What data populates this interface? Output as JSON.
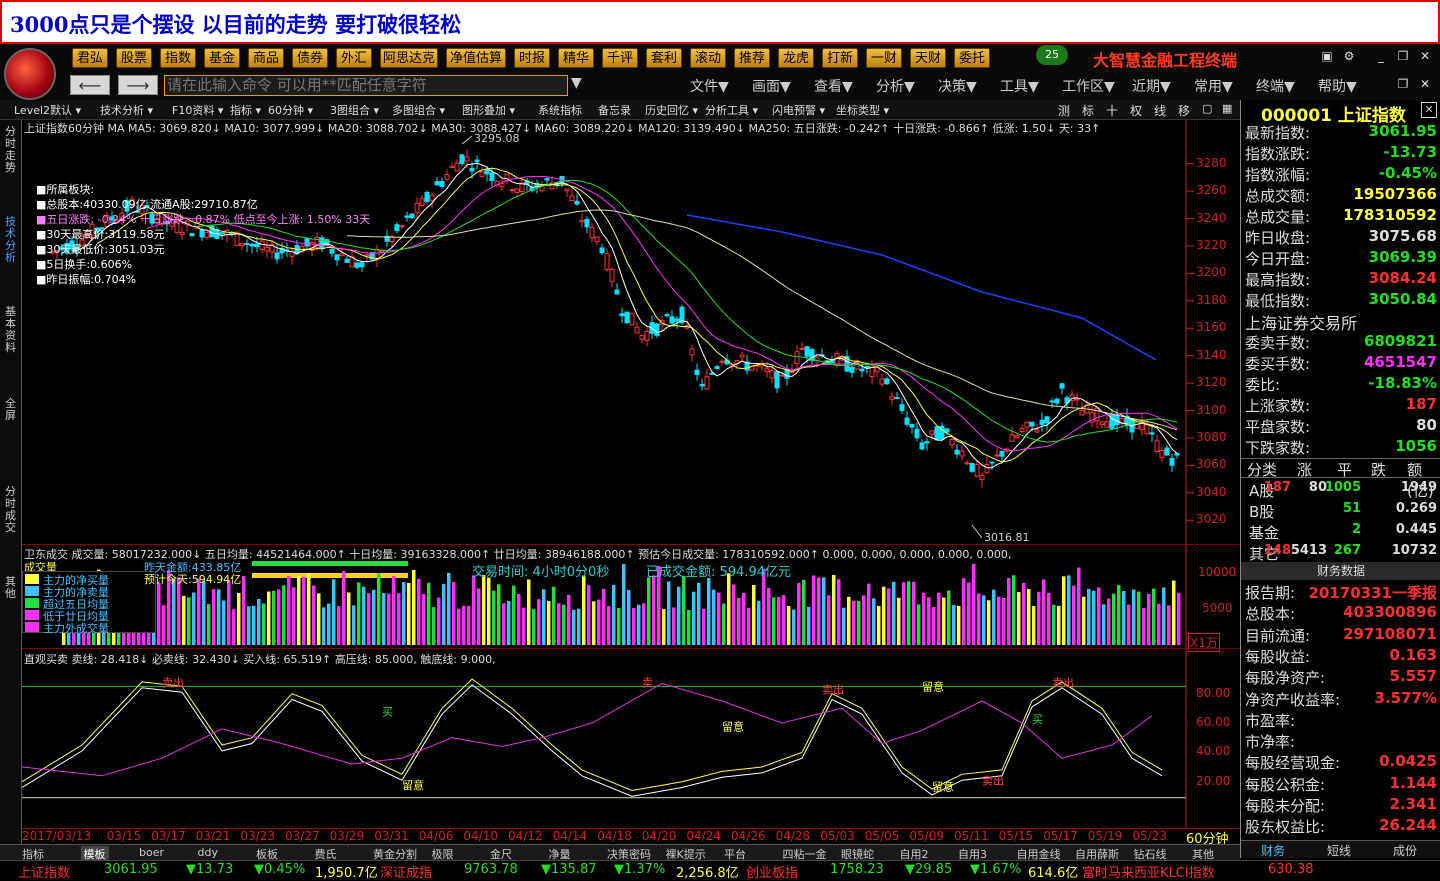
{
  "title": "3000点只是个摆设 以目前的走势 要打破很轻松",
  "app": {
    "name": "大智慧金融工程终端",
    "badge": "25",
    "cmd_placeholder": "请在此输入命令   可以用**匹配任意字符"
  },
  "main_buttons": [
    "君弘",
    "股票",
    "指数",
    "基金",
    "商品",
    "债券",
    "外汇",
    "阿思达克",
    "净值估算",
    "时报",
    "精华",
    "千评",
    "套利",
    "滚动",
    "推荐",
    "龙虎",
    "打新",
    "一财",
    "天财",
    "委托"
  ],
  "menus": [
    "文件▼",
    "画面▼",
    "查看▼",
    "分析▼",
    "决策▼",
    "工具▼",
    "工作区▼",
    "近期▼",
    "常用▼",
    "终端▼",
    "帮助▼"
  ],
  "toolbar": [
    "Level2默认",
    "技术分析",
    "F10资料",
    "指标",
    "60分钟",
    "3图组合",
    "多图组合",
    "图形叠加",
    "系统指标",
    "备忘录",
    "历史回忆",
    "分析工具",
    "闪电预警",
    "坐标类型"
  ],
  "toolbar_right": [
    "测",
    "标",
    "十",
    "权",
    "线",
    "移"
  ],
  "left_tabs": [
    "分时走势",
    "技术分析",
    "基本资料",
    "全屏",
    "分时成交",
    "其他"
  ],
  "main_chart": {
    "header": "上证指数60分钟 MA MA5: 3069.820↓ MA10: 3077.999↓ MA20: 3088.702↓ MA30: 3088.427↓ MA60: 3089.220↓ MA120: 3139.490↓ MA250: 五日涨跌: -0.242↑ 十日涨跌: -0.866↑ 低涨: 1.50↓ 天: 33↑",
    "info": [
      "■所属板块:",
      "■总股本:40330.09亿  流通A股:29710.87亿",
      "■五日涨跌: -0.24%  十日涨跌: -0.87%  低点至今上涨: 1.50%  33天",
      "■30天最高价:3119.58元",
      "■30天最低价:3051.03元",
      "■5日换手:0.606%",
      "■昨日振幅:0.704%"
    ],
    "high_label": "3295.08",
    "low_label": "3016.81",
    "y_ticks": [
      "3280",
      "3260",
      "3240",
      "3220",
      "3200",
      "3180",
      "3160",
      "3140",
      "3120",
      "3100",
      "3080",
      "3060",
      "3040",
      "3020"
    ]
  },
  "volume": {
    "header": "卫东成交 成交量: 58017232.000↓ 五日均量: 44521464.000↑ 十日均量: 39163328.000↑ 廿日均量: 38946188.000↑ 预估今日成交量: 178310592.000↑ 0.000, 0.000, 0.000, 0.000, 0.000,",
    "title": "成交量",
    "legend": [
      "主力的净买量",
      "主力的净卖量",
      "超过五日均量",
      "低于廿日均量",
      "主力外成交量"
    ],
    "yesterday": "昨天金额:433.85亿",
    "today_est": "预计今天:594.94亿",
    "trade_time": "交易时间: 4小时0分0秒",
    "traded_amount": "已成交金额: 594.94亿元",
    "y_ticks": [
      "10000",
      "5000"
    ],
    "unit": "X1万"
  },
  "osc": {
    "header": "直观买卖 卖线: 28.418↓ 必卖线: 32.430↓ 买入线: 65.519↑ 高压线: 85.000, 触底线: 9.000,",
    "y_ticks": [
      "80.00",
      "60.00",
      "40.00",
      "20.00"
    ],
    "signals": [
      "卖出",
      "留意",
      "买",
      "卖",
      "留意",
      "卖出",
      "留意",
      "卖出",
      "留意",
      "卖出",
      "买"
    ]
  },
  "x_dates": [
    "2017/03/13",
    "03/15",
    "03/17",
    "03/21",
    "03/23",
    "03/27",
    "03/29",
    "03/31",
    "04/06",
    "04/10",
    "04/12",
    "04/14",
    "04/18",
    "04/20",
    "04/24",
    "04/26",
    "04/28",
    "05/03",
    "05/05",
    "05/09",
    "05/11",
    "05/15",
    "05/17",
    "05/19",
    "05/23"
  ],
  "period": "60分钟",
  "quote": {
    "code": "000001",
    "name": "上证指数",
    "rows": [
      {
        "k": "最新指数:",
        "v": "3061.95",
        "c": "#20e020"
      },
      {
        "k": "指数涨跌:",
        "v": "-13.73",
        "c": "#20e020"
      },
      {
        "k": "指数涨幅:",
        "v": "-0.45%",
        "c": "#20e020"
      },
      {
        "k": "总成交额:",
        "v": "19507366",
        "c": "#ffff40"
      },
      {
        "k": "总成交量:",
        "v": "178310592",
        "c": "#ffff40"
      },
      {
        "k": "昨日收盘:",
        "v": "3075.68",
        "c": "#ddd"
      },
      {
        "k": "今日开盘:",
        "v": "3069.39",
        "c": "#20e020"
      },
      {
        "k": "最高指数:",
        "v": "3084.24",
        "c": "#ff3030"
      },
      {
        "k": "最低指数:",
        "v": "3050.84",
        "c": "#20e020"
      }
    ],
    "exchange": "上海证券交易所",
    "rows2": [
      {
        "k": "委卖手数:",
        "v": "6809821",
        "c": "#20e020"
      },
      {
        "k": "委买手数:",
        "v": "4651547",
        "c": "#ff30ff"
      },
      {
        "k": "委比:",
        "v": "-18.83%",
        "c": "#20e020"
      },
      {
        "k": "上涨家数:",
        "v": "187",
        "c": "#ff3030"
      },
      {
        "k": "平盘家数:",
        "v": "80",
        "c": "#ddd"
      },
      {
        "k": "下跌家数:",
        "v": "1056",
        "c": "#20e020"
      }
    ],
    "breakdown_header": [
      "分类",
      "涨",
      "平",
      "跌",
      "额(亿)"
    ],
    "breakdown": [
      [
        "A股",
        "187",
        "80",
        "1005",
        "1949"
      ],
      [
        "B股",
        "",
        "",
        "51",
        "0.269"
      ],
      [
        "基金",
        "",
        "",
        "2",
        "0.445"
      ],
      [
        "其它",
        "148",
        "5413",
        "267",
        "10732"
      ]
    ],
    "fin_title": "财务数据",
    "fin": [
      {
        "k": "报告期:",
        "v": "20170331一季报",
        "c": "#ff3030"
      },
      {
        "k": "总股本:",
        "v": "403300896",
        "c": "#ff3030"
      },
      {
        "k": "目前流通:",
        "v": "297108071",
        "c": "#ff3030"
      },
      {
        "k": "每股收益:",
        "v": "0.163",
        "c": "#ff3030"
      },
      {
        "k": "每股净资产:",
        "v": "5.557",
        "c": "#ff3030"
      },
      {
        "k": "净资产收益率:",
        "v": "3.577%",
        "c": "#ff3030"
      },
      {
        "k": "市盈率:",
        "v": "",
        "c": "#ff3030"
      },
      {
        "k": "市净率:",
        "v": "",
        "c": "#ff3030"
      },
      {
        "k": "每股经营现金:",
        "v": "0.0425",
        "c": "#ff3030"
      },
      {
        "k": "每股公积金:",
        "v": "1.144",
        "c": "#ff3030"
      },
      {
        "k": "每股未分配:",
        "v": "2.341",
        "c": "#ff3030"
      },
      {
        "k": "股东权益比:",
        "v": "26.244",
        "c": "#ff3030"
      }
    ],
    "bottom_tabs": [
      "财务",
      "短线",
      "成份"
    ]
  },
  "bottom_tabs": [
    "指标",
    "模板",
    "boer",
    "ddy",
    "板板",
    "费氏",
    "黄金分割",
    "极限",
    "金尺",
    "净量",
    "决策密码",
    "裸K提示",
    "平台",
    "四粘一金",
    "眼镜蛇",
    "自用2",
    "自用3",
    "自用金线",
    "自用薛斯",
    "钻石线",
    "其他"
  ],
  "ticker": [
    {
      "t": "上证指数",
      "c": "#ff3030"
    },
    {
      "t": "3061.95",
      "c": "#20e020"
    },
    {
      "t": "▼13.73",
      "c": "#20e020"
    },
    {
      "t": "▼0.45%",
      "c": "#20e020"
    },
    {
      "t": "1,950.7亿",
      "c": "#ffff40"
    },
    {
      "t": "深证成指",
      "c": "#ff3030"
    },
    {
      "t": "9763.78",
      "c": "#20e020"
    },
    {
      "t": "▼135.87",
      "c": "#20e020"
    },
    {
      "t": "▼1.37%",
      "c": "#20e020"
    },
    {
      "t": "2,256.8亿",
      "c": "#ffff40"
    },
    {
      "t": "创业板指",
      "c": "#ff3030"
    },
    {
      "t": "1758.23",
      "c": "#20e020"
    },
    {
      "t": "▼29.85",
      "c": "#20e020"
    },
    {
      "t": "▼1.67%",
      "c": "#20e020"
    },
    {
      "t": "614.6亿",
      "c": "#ffff40"
    },
    {
      "t": "富时马来西亚KLCI指数",
      "c": "#ff3030"
    },
    {
      "t": "630.38",
      "c": "#ff3030"
    }
  ]
}
